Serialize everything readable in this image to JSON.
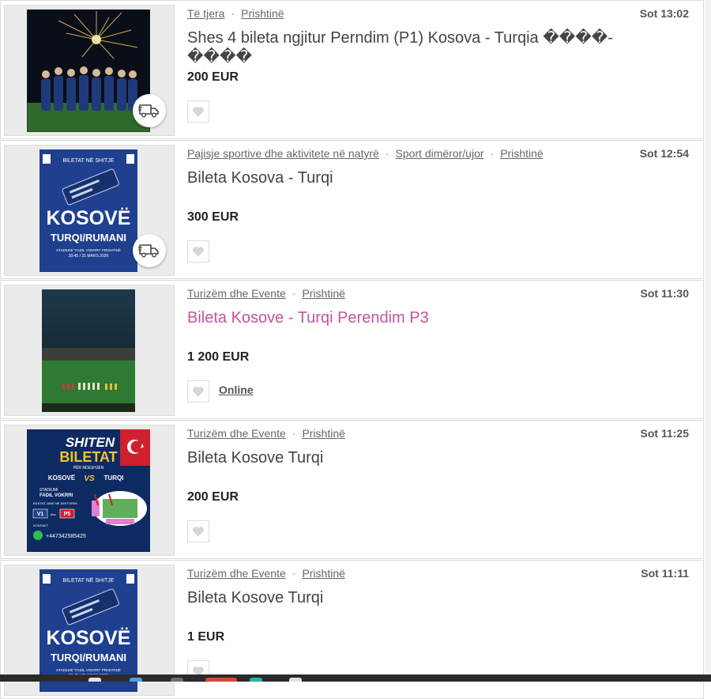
{
  "listings": [
    {
      "crumbs": [
        "Të tjera",
        "Prishtinë"
      ],
      "time": "Sot 13:02",
      "title": "Shes 4 bileta ngjitur Perndim (P1) Kosova - Turqia ����- ����",
      "price": "200 EUR",
      "highlighted": false,
      "delivery": true,
      "online": null,
      "image": "team-photo-fireworks"
    },
    {
      "crumbs": [
        "Pajisje sportive dhe aktivitete në natyrë",
        "Sport dimëror/ujor",
        "Prishtinë"
      ],
      "time": "Sot 12:54",
      "title": "Bileta Kosova - Turqi",
      "price": "300 EUR",
      "highlighted": false,
      "delivery": true,
      "online": null,
      "image": "ticket-poster"
    },
    {
      "crumbs": [
        "Turizëm dhe Evente",
        "Prishtinë"
      ],
      "time": "Sot 11:30",
      "title": "Bileta Kosove - Turqi Perendim P3",
      "price": "1 200 EUR",
      "highlighted": true,
      "delivery": false,
      "online": "Online",
      "image": "stadium-night"
    },
    {
      "crumbs": [
        "Turizëm dhe Evente",
        "Prishtinë"
      ],
      "time": "Sot 11:25",
      "title": "Bileta Kosove Turqi",
      "price": "200 EUR",
      "highlighted": false,
      "delivery": false,
      "online": null,
      "image": "sale-flyer"
    },
    {
      "crumbs": [
        "Turizëm dhe Evente",
        "Prishtinë"
      ],
      "time": "Sot 11:11",
      "title": "Bileta Kosove Turqi",
      "price": "1 EUR",
      "highlighted": false,
      "delivery": false,
      "online": null,
      "image": "ticket-poster"
    }
  ],
  "poster": {
    "header": "BILETAT NË SHITJE",
    "line1": "KOSOVË",
    "line2": "TURQI/RUMANI",
    "line3": "STADIUMI \"FADIL VOKRRI\" PRISHTINË",
    "line4": "20:45 / 31 MARS 2026"
  },
  "flyer": {
    "line1": "SHITEN",
    "line2": "BILETAT",
    "line3": "PËR NDESHJEN",
    "team1": "KOSOVË",
    "vs": "VS",
    "team2": "TURQI",
    "stadium_label": "STADIUMI",
    "stadium_name": "FADIL VOKRRI",
    "sectors_label": "BILETAT JANË NË SEKTORIN:",
    "sector1": "V1",
    "sector_and": "dhe",
    "sector2": "P5",
    "contact_label": "KONTAKT:",
    "phone": "+447342585425"
  },
  "colors": {
    "highlight_title": "#c2559d",
    "poster_blue": "#1f3f8f",
    "flyer_red": "#d0202e"
  }
}
